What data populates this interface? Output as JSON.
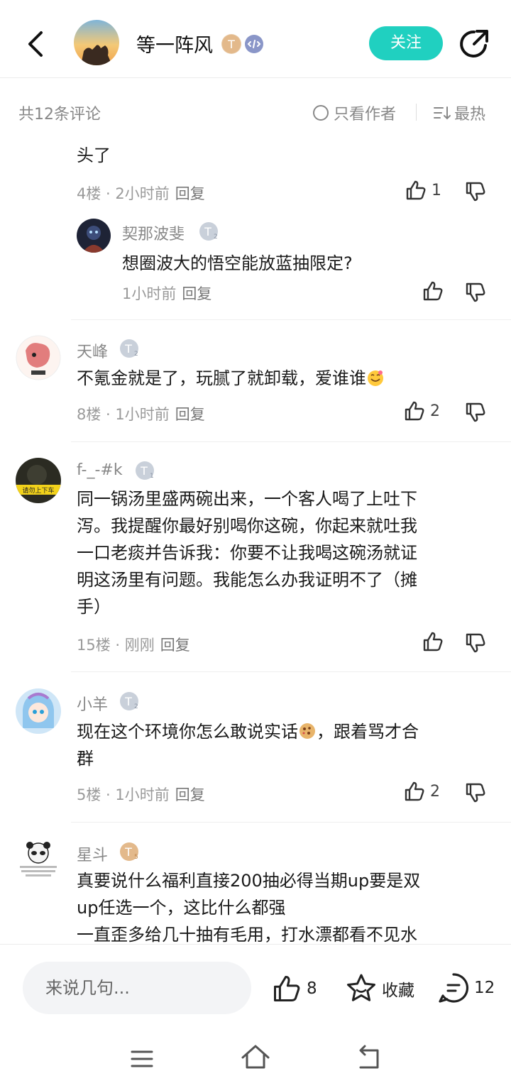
{
  "header": {
    "title": "等一阵风",
    "follow_label": "关注"
  },
  "toolbar": {
    "count_label": "共12条评论",
    "only_author_label": "只看作者",
    "sort_label": "最热"
  },
  "comments": [
    {
      "text": "头了",
      "floor": "4楼",
      "time": "2小时前",
      "reply_label": "回复",
      "likes": "1",
      "sub": {
        "name": "契那波斐",
        "level": "2",
        "text": "想圈波大的悟空能放蓝抽限定?",
        "time": "1小时前",
        "reply_label": "回复"
      }
    },
    {
      "name": "天峰",
      "level": "2",
      "text": "不氪金就是了，玩腻了就卸载，爱谁谁",
      "floor": "8楼",
      "time": "1小时前",
      "reply_label": "回复",
      "likes": "2"
    },
    {
      "name": "f-_-#k",
      "level": "1",
      "text_lines": [
        "同一锅汤里盛两碗出来，一个客人喝了上吐下",
        "泻。我提醒你最好别喝你这碗，你起来就吐我",
        "一口老痰并告诉我：你要不让我喝这碗汤就证",
        "明这汤里有问题。我能怎么办我证明不了（摊",
        "手）"
      ],
      "floor": "15楼",
      "time": "刚刚",
      "reply_label": "回复"
    },
    {
      "name": "小羊",
      "level": "2",
      "text_lines": [
        "现在这个环境你怎么敢说实话",
        "，跟着骂才合",
        "群"
      ],
      "floor": "5楼",
      "time": "1小时前",
      "reply_label": "回复",
      "likes": "2"
    },
    {
      "name": "星斗",
      "level": "5",
      "text_lines": [
        "真要说什么福利直接200抽必得当期up要是双",
        "up任选一个，这比什么都强",
        "一直歪多给几十抽有毛用，打水漂都看不见水"
      ]
    }
  ],
  "bottombar": {
    "placeholder": "来说几句...",
    "like_count": "8",
    "favorite_label": "收藏",
    "comment_count": "12"
  },
  "colors": {
    "accent": "#20d0c0",
    "muted": "#9a9a9a"
  }
}
